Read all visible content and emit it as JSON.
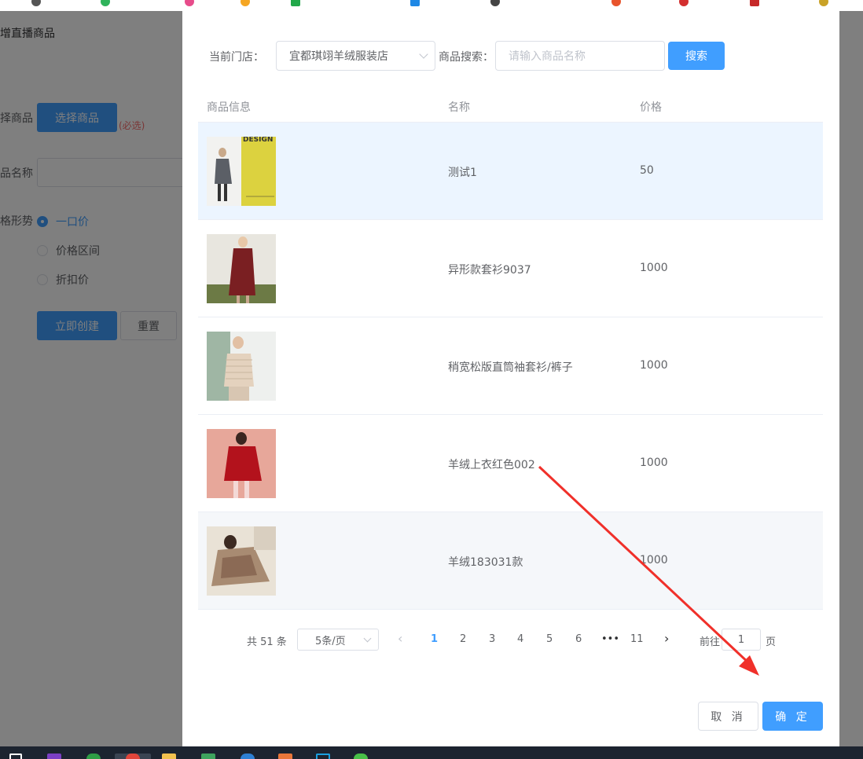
{
  "background_page": {
    "title": "新增直播商品",
    "form": {
      "choose_label": "选择商品",
      "choose_button": "选择商品",
      "required": "(必选)",
      "name_label": "商品名称",
      "price_form_label": "价格形势",
      "radio_options": [
        "一口价",
        "价格区间",
        "折扣价"
      ],
      "selected_radio": "一口价",
      "create_button": "立即创建",
      "reset_button": "重置"
    }
  },
  "dialog": {
    "filter": {
      "store_label": "当前门店：",
      "store_value": "宜都琪翊羊绒服装店",
      "search_label": "商品搜索：",
      "search_placeholder": "请输入商品名称",
      "search_button": "搜索"
    },
    "table": {
      "columns": [
        "商品信息",
        "名称",
        "价格"
      ],
      "rows": [
        {
          "name": "测试1",
          "price": "50",
          "thumb_text": "DESIGN"
        },
        {
          "name": "异形款套衫9037",
          "price": "1000"
        },
        {
          "name": "稍宽松版直筒袖套衫/裤子",
          "price": "1000"
        },
        {
          "name": "羊绒上衣红色002",
          "price": "1000"
        },
        {
          "name": "羊绒183031款",
          "price": "1000"
        }
      ]
    },
    "pagination": {
      "total": "共 51 条",
      "page_size": "5条/页",
      "pages": [
        "1",
        "2",
        "3",
        "4",
        "5",
        "6"
      ],
      "ellipsis": "•••",
      "last_page": "11",
      "current_page": "1",
      "goto_prefix": "前往",
      "goto_value": "1",
      "goto_suffix": "页"
    },
    "footer": {
      "cancel": "取 消",
      "confirm": "确 定"
    }
  },
  "annotation": {
    "arrow_color": "#f0302a"
  },
  "colors": {
    "primary": "#409eff",
    "selected_row": "#ecf5ff"
  }
}
